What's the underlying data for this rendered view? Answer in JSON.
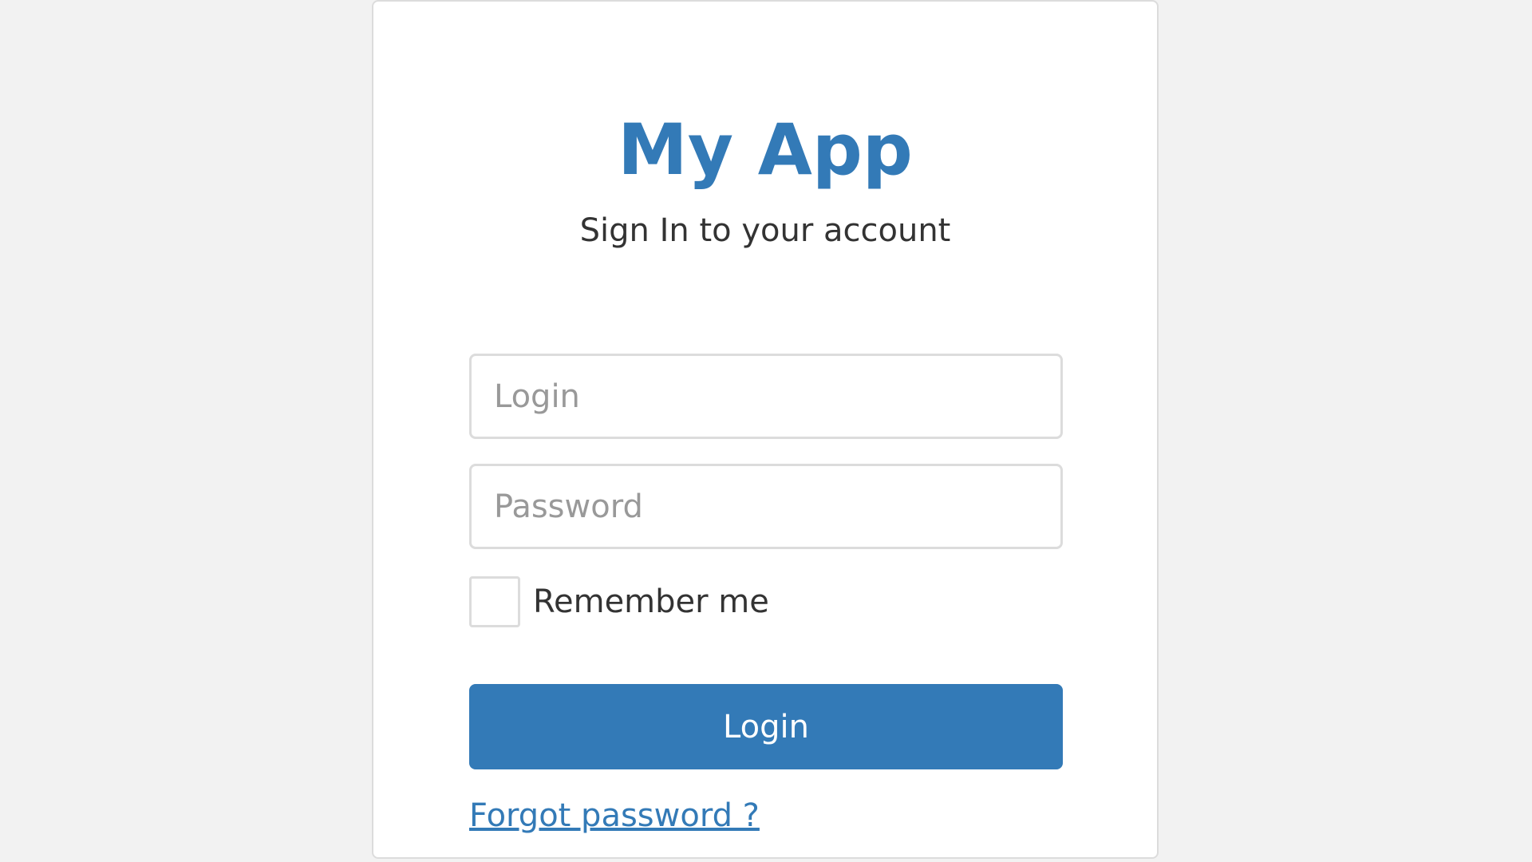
{
  "app": {
    "title": "My App",
    "subtitle": "Sign In to your account"
  },
  "form": {
    "login_placeholder": "Login",
    "login_value": "",
    "password_placeholder": "Password",
    "password_value": "",
    "remember_label": "Remember me",
    "remember_checked": false,
    "submit_label": "Login",
    "forgot_label": "Forgot password ?"
  },
  "colors": {
    "accent": "#337ab7",
    "background": "#f2f2f2",
    "card": "#ffffff",
    "border": "#dcdcdc",
    "text": "#333333",
    "placeholder": "#999999"
  }
}
